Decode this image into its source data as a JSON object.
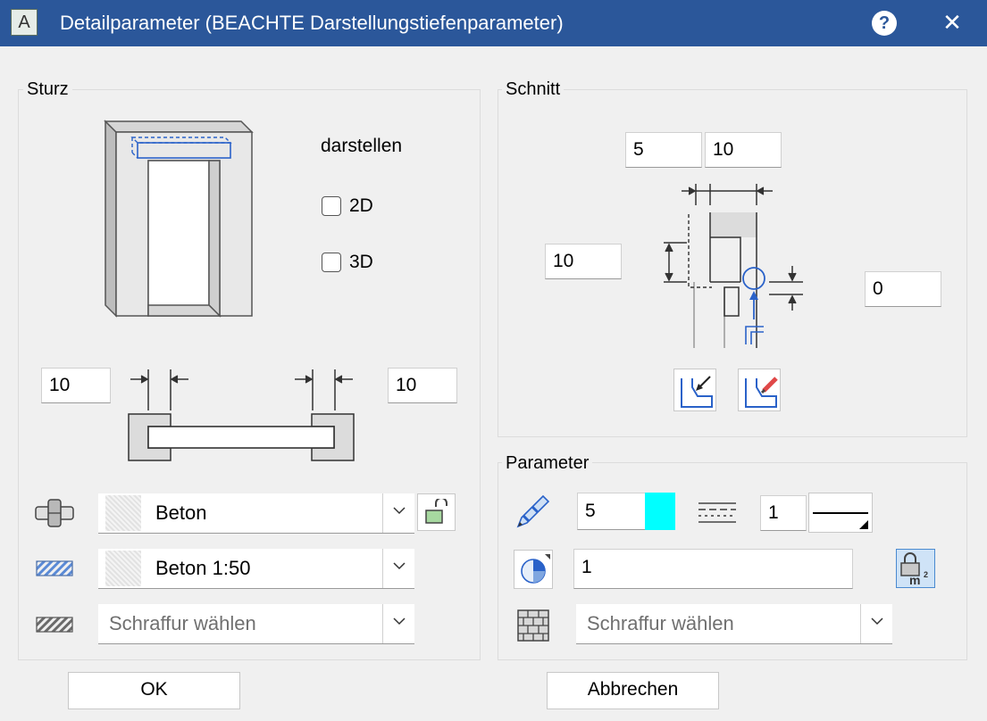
{
  "window": {
    "title": "Detailparameter (BEACHTE Darstellungstiefenparameter)",
    "app_icon_letter": "A"
  },
  "sturz": {
    "title": "Sturz",
    "darstellen_label": "darstellen",
    "check_2d": {
      "label": "2D",
      "checked": false
    },
    "check_3d": {
      "label": "3D",
      "checked": false
    },
    "left_value": "10",
    "right_value": "10",
    "material": "Beton",
    "material_lock": "unlocked",
    "hatch": "Beton 1:50",
    "fill_placeholder": "Schraffur wählen"
  },
  "schnitt": {
    "title": "Schnitt",
    "top_left_value": "5",
    "top_right_value": "10",
    "left_value": "10",
    "right_value": "0"
  },
  "parameter": {
    "title": "Parameter",
    "pen_value": "5",
    "pen_color": "#00ffff",
    "line_value": "1",
    "area_value": "1",
    "fill_placeholder": "Schraffur wählen"
  },
  "buttons": {
    "ok": "OK",
    "cancel": "Abbrechen"
  }
}
